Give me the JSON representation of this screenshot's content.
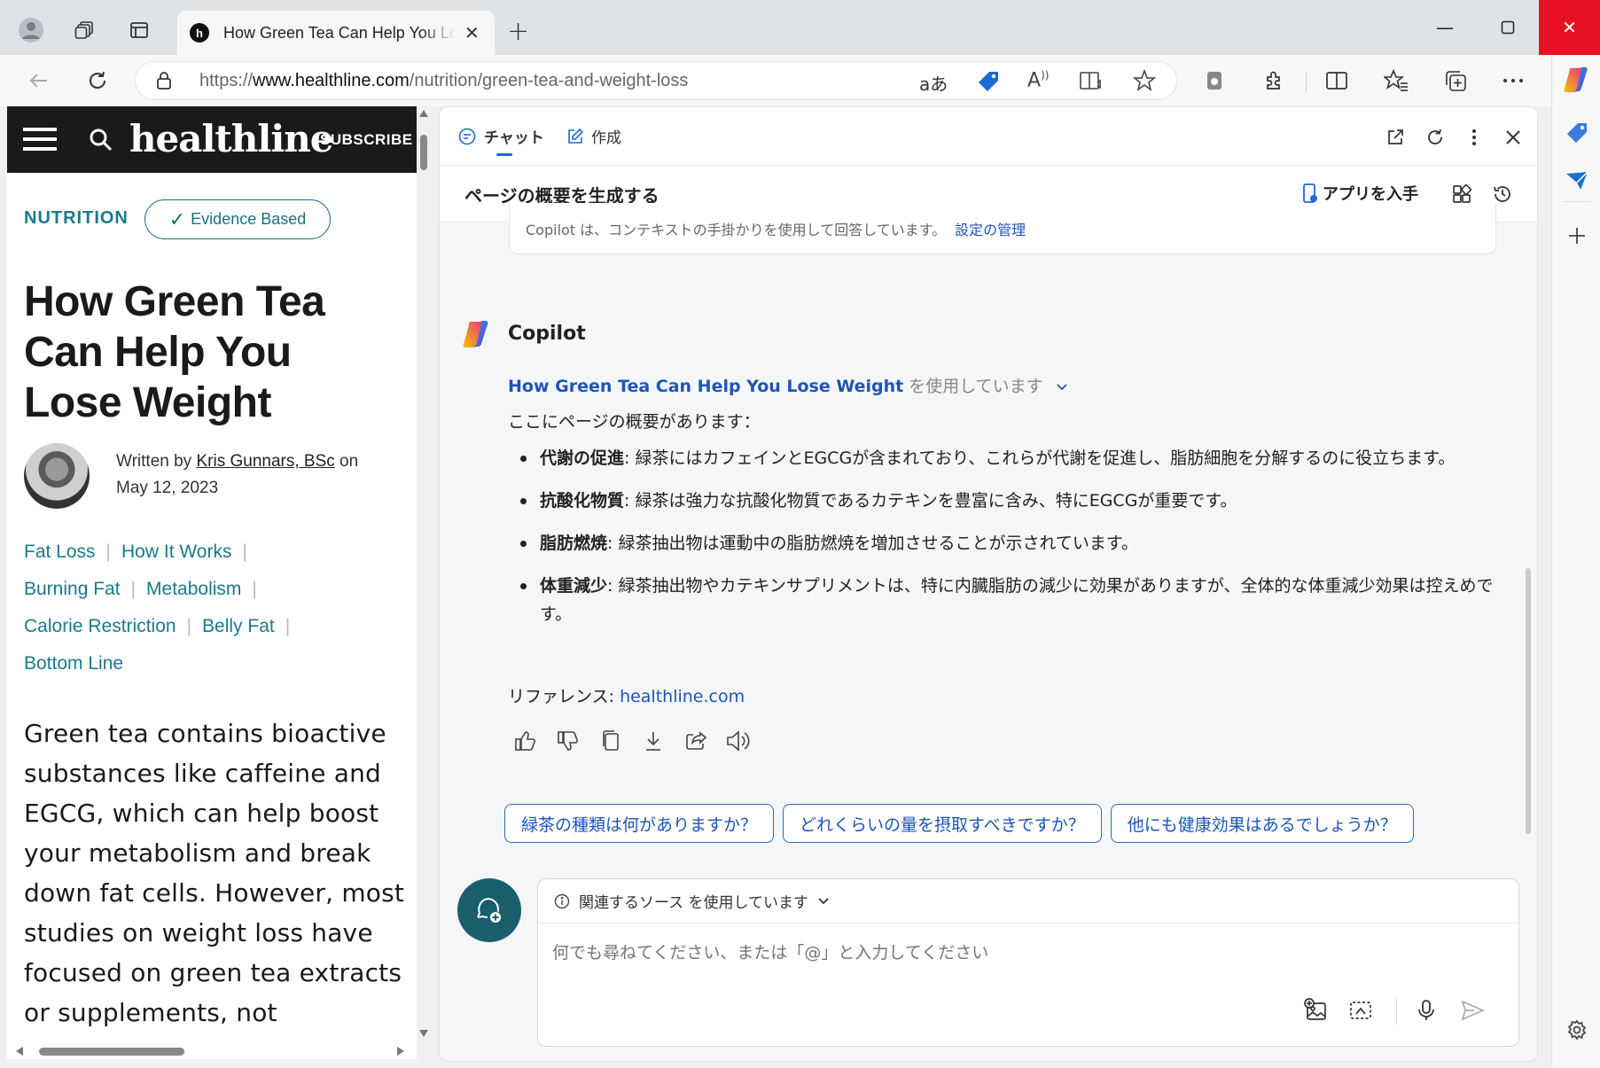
{
  "browser": {
    "tab_title": "How Green Tea Can Help You Lose Weight",
    "url_prefix": "https://",
    "url_domain": "www.healthline.com",
    "url_path": "/nutrition/green-tea-and-weight-loss",
    "translate_label": "aあ",
    "read_aloud_label": "A",
    "accent": "#1d6ad6",
    "close_color": "#e81123"
  },
  "page": {
    "logo": "healthline",
    "subscribe": "SUBSCRIBE",
    "category": "NUTRITION",
    "evidence": "Evidence Based",
    "headline": "How Green Tea Can Help You Lose Weight",
    "byline_prefix": "Written by ",
    "author": "Kris Gunnars, BSc",
    "byline_suffix": " on",
    "date": "May 12, 2023",
    "toc": [
      "Fat Loss",
      "How It Works",
      "Burning Fat",
      "Metabolism",
      "Calorie Restriction",
      "Belly Fat",
      "Bottom Line"
    ],
    "body": "Green tea contains bioactive substances like caffeine and EGCG, which can help boost your metabolism and break down fat cells. However, most studies on weight loss have focused on green tea extracts or supplements, not"
  },
  "copilot": {
    "tab_chat": "チャット",
    "tab_compose": "作成",
    "header_title": "ページの概要を生成する",
    "get_app": "アプリを入手",
    "context_text": "Copilot は、コンテキストの手掛かりを使用して回答しています。",
    "context_link": "設定の管理",
    "name": "Copilot",
    "source_title": "How Green Tea Can Help You Lose Weight",
    "source_suffix": "を使用しています",
    "intro": "ここにページの概要があります：",
    "bullets": [
      {
        "term": "代謝の促進",
        "text": ": 緑茶にはカフェインとEGCGが含まれており、これらが代謝を促進し、脂肪細胞を分解するのに役立ちます。"
      },
      {
        "term": "抗酸化物質",
        "text": ": 緑茶は強力な抗酸化物質であるカテキンを豊富に含み、特にEGCGが重要です。"
      },
      {
        "term": "脂肪燃焼",
        "text": ": 緑茶抽出物は運動中の脂肪燃焼を増加させることが示されています。"
      },
      {
        "term": "体重減少",
        "text": ": 緑茶抽出物やカテキンサプリメントは、特に内臓脂肪の減少に効果がありますが、全体的な体重減少効果は控えめです。"
      }
    ],
    "reference_label": "リファレンス: ",
    "reference_link": "healthline.com",
    "chips": [
      "緑茶の種類は何がありますか？",
      "どれくらいの量を摂取すべきですか？",
      "他にも健康効果はあるでしょうか？"
    ],
    "sources_label": "関連するソース を使用しています",
    "prompt_placeholder": "何でも尋ねてください、または「@」と入力してください"
  }
}
